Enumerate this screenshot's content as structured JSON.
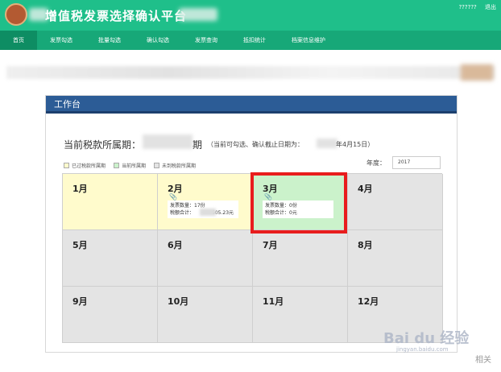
{
  "header": {
    "title": "增值税发票选择确认平台",
    "user": [
      "??????",
      "退出"
    ]
  },
  "nav": {
    "items": [
      "首页",
      "发票勾选",
      "批量勾选",
      "确认勾选",
      "发票查询",
      "抵扣统计",
      "档案信息维护"
    ]
  },
  "panel": {
    "title": "工作台",
    "period_label": "当前税款所属期：",
    "period_tail": "期",
    "deadline_label": "（当前可勾选、确认截止日期为：",
    "deadline_tail": "年4月15日）",
    "legend": [
      "已过税款所属期",
      "当前所属期",
      "未到税款所属期"
    ],
    "year_label": "年度：",
    "year_value": "2017"
  },
  "calendar": {
    "months": [
      {
        "label": "1月",
        "state": "past"
      },
      {
        "label": "2月",
        "state": "past",
        "invoice_count": "发票数量：17份",
        "tax_total": "税额合计：",
        "tax_value": "605.23元"
      },
      {
        "label": "3月",
        "state": "current",
        "invoice_count": "发票数量：0份",
        "tax_total": "税额合计：0元"
      },
      {
        "label": "4月",
        "state": "future"
      },
      {
        "label": "5月",
        "state": "future"
      },
      {
        "label": "6月",
        "state": "future"
      },
      {
        "label": "7月",
        "state": "future"
      },
      {
        "label": "8月",
        "state": "future"
      },
      {
        "label": "9月",
        "state": "future"
      },
      {
        "label": "10月",
        "state": "future"
      },
      {
        "label": "11月",
        "state": "future"
      },
      {
        "label": "12月",
        "state": "future"
      }
    ]
  },
  "watermark": {
    "brand": "Bai du 经验",
    "url": "jingyan.baidu.com",
    "corner": "相关"
  },
  "colors": {
    "header": "#1fbf8a",
    "nav": "#17a878",
    "panel_head": "#2c5c96",
    "past": "#fffbcc",
    "current": "#cbf2cb",
    "future": "#e4e4e4",
    "highlight": "#e81d1d"
  }
}
